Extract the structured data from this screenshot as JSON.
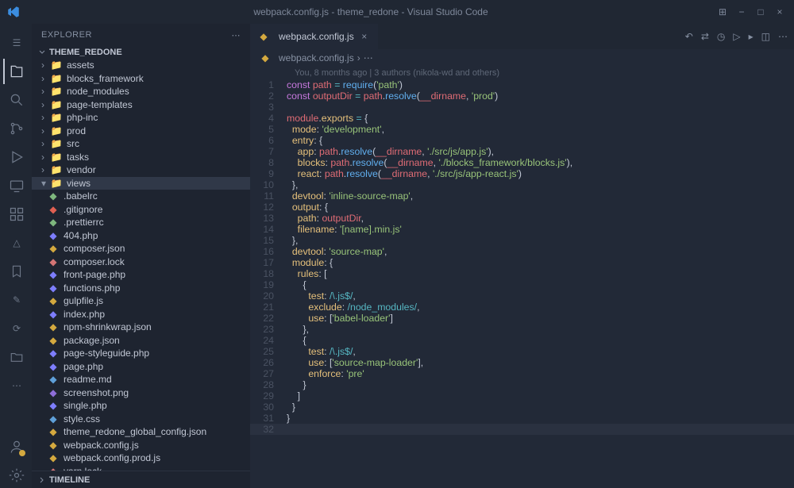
{
  "titlebar": {
    "title": "webpack.config.js - theme_redone - Visual Studio Code"
  },
  "sidebar": {
    "header": "EXPLORER",
    "project": "THEME_REDONE",
    "folders": [
      {
        "name": "assets"
      },
      {
        "name": "blocks_framework"
      },
      {
        "name": "node_modules"
      },
      {
        "name": "page-templates"
      },
      {
        "name": "php-inc"
      },
      {
        "name": "prod"
      },
      {
        "name": "src"
      },
      {
        "name": "tasks"
      },
      {
        "name": "vendor"
      },
      {
        "name": "views"
      }
    ],
    "files": [
      {
        "name": ".babelrc",
        "cls": "ico-conf"
      },
      {
        "name": ".gitignore",
        "cls": "ico-git"
      },
      {
        "name": ".prettierrc",
        "cls": "ico-conf"
      },
      {
        "name": "404.php",
        "cls": "ico-php"
      },
      {
        "name": "composer.json",
        "cls": "ico-json"
      },
      {
        "name": "composer.lock",
        "cls": "ico-lock"
      },
      {
        "name": "front-page.php",
        "cls": "ico-php"
      },
      {
        "name": "functions.php",
        "cls": "ico-php"
      },
      {
        "name": "gulpfile.js",
        "cls": "ico-js"
      },
      {
        "name": "index.php",
        "cls": "ico-php"
      },
      {
        "name": "npm-shrinkwrap.json",
        "cls": "ico-json"
      },
      {
        "name": "package.json",
        "cls": "ico-json"
      },
      {
        "name": "page-styleguide.php",
        "cls": "ico-php"
      },
      {
        "name": "page.php",
        "cls": "ico-php"
      },
      {
        "name": "readme.md",
        "cls": "ico-md"
      },
      {
        "name": "screenshot.png",
        "cls": "ico-img"
      },
      {
        "name": "single.php",
        "cls": "ico-php"
      },
      {
        "name": "style.css",
        "cls": "ico-css"
      },
      {
        "name": "theme_redone_global_config.json",
        "cls": "ico-json"
      },
      {
        "name": "webpack.config.js",
        "cls": "ico-js"
      },
      {
        "name": "webpack.config.prod.js",
        "cls": "ico-js"
      },
      {
        "name": "yarn.lock",
        "cls": "ico-lock"
      }
    ],
    "timeline": "TIMELINE"
  },
  "tab": {
    "name": "webpack.config.js"
  },
  "breadcrumb": {
    "file": "webpack.config.js"
  },
  "blame": "You, 8 months ago | 3 authors (nikola-wd and others)",
  "code": [
    {
      "n": 1,
      "h": "<span class='kw'>const</span> <span class='var'>path</span> <span class='op'>=</span> <span class='fn'>require</span>(<span class='str'>'path'</span>)"
    },
    {
      "n": 2,
      "h": "<span class='kw'>const</span> <span class='var'>outputDir</span> <span class='op'>=</span> <span class='var'>path</span>.<span class='fn'>resolve</span>(<span class='var'>__dirname</span>, <span class='str'>'prod'</span>)"
    },
    {
      "n": 3,
      "h": ""
    },
    {
      "n": 4,
      "h": "<span class='var'>module</span>.<span class='prop'>exports</span> <span class='op'>=</span> {"
    },
    {
      "n": 5,
      "h": "  <span class='prop'>mode</span>: <span class='str'>'development'</span>,"
    },
    {
      "n": 6,
      "h": "  <span class='prop'>entry</span>: {"
    },
    {
      "n": 7,
      "h": "    <span class='prop'>app</span>: <span class='var'>path</span>.<span class='fn'>resolve</span>(<span class='var'>__dirname</span>, <span class='str'>'./src/js/app.js'</span>),"
    },
    {
      "n": 8,
      "h": "    <span class='prop'>blocks</span>: <span class='var'>path</span>.<span class='fn'>resolve</span>(<span class='var'>__dirname</span>, <span class='str'>'./blocks_framework/blocks.js'</span>),"
    },
    {
      "n": 9,
      "h": "    <span class='prop'>react</span>: <span class='var'>path</span>.<span class='fn'>resolve</span>(<span class='var'>__dirname</span>, <span class='str'>'./src/js/app-react.js'</span>)"
    },
    {
      "n": 10,
      "h": "  },"
    },
    {
      "n": 11,
      "h": "  <span class='prop'>devtool</span>: <span class='str'>'inline-source-map'</span>,"
    },
    {
      "n": 12,
      "h": "  <span class='prop'>output</span>: {"
    },
    {
      "n": 13,
      "h": "    <span class='prop'>path</span>: <span class='var'>outputDir</span>,"
    },
    {
      "n": 14,
      "h": "    <span class='prop'>filename</span>: <span class='str'>'[name].min.js'</span>"
    },
    {
      "n": 15,
      "h": "  },"
    },
    {
      "n": 16,
      "h": "  <span class='prop'>devtool</span>: <span class='str'>'source-map'</span>,"
    },
    {
      "n": 17,
      "h": "  <span class='prop'>module</span>: {"
    },
    {
      "n": 18,
      "h": "    <span class='prop'>rules</span>: ["
    },
    {
      "n": 19,
      "h": "      {"
    },
    {
      "n": 20,
      "h": "        <span class='prop'>test</span>: <span class='op'>/\\.js$/</span>,"
    },
    {
      "n": 21,
      "h": "        <span class='prop'>exclude</span>: <span class='op'>/node_modules/</span>,"
    },
    {
      "n": 22,
      "h": "        <span class='prop'>use</span>: [<span class='str'>'babel-loader'</span>]"
    },
    {
      "n": 23,
      "h": "      },"
    },
    {
      "n": 24,
      "h": "      {"
    },
    {
      "n": 25,
      "h": "        <span class='prop'>test</span>: <span class='op'>/\\.js$/</span>,"
    },
    {
      "n": 26,
      "h": "        <span class='prop'>use</span>: [<span class='str'>'source-map-loader'</span>],"
    },
    {
      "n": 27,
      "h": "        <span class='prop'>enforce</span>: <span class='str'>'pre'</span>"
    },
    {
      "n": 28,
      "h": "      }"
    },
    {
      "n": 29,
      "h": "    ]"
    },
    {
      "n": 30,
      "h": "  }"
    },
    {
      "n": 31,
      "h": "}"
    },
    {
      "n": 32,
      "h": " ",
      "active": true
    }
  ]
}
